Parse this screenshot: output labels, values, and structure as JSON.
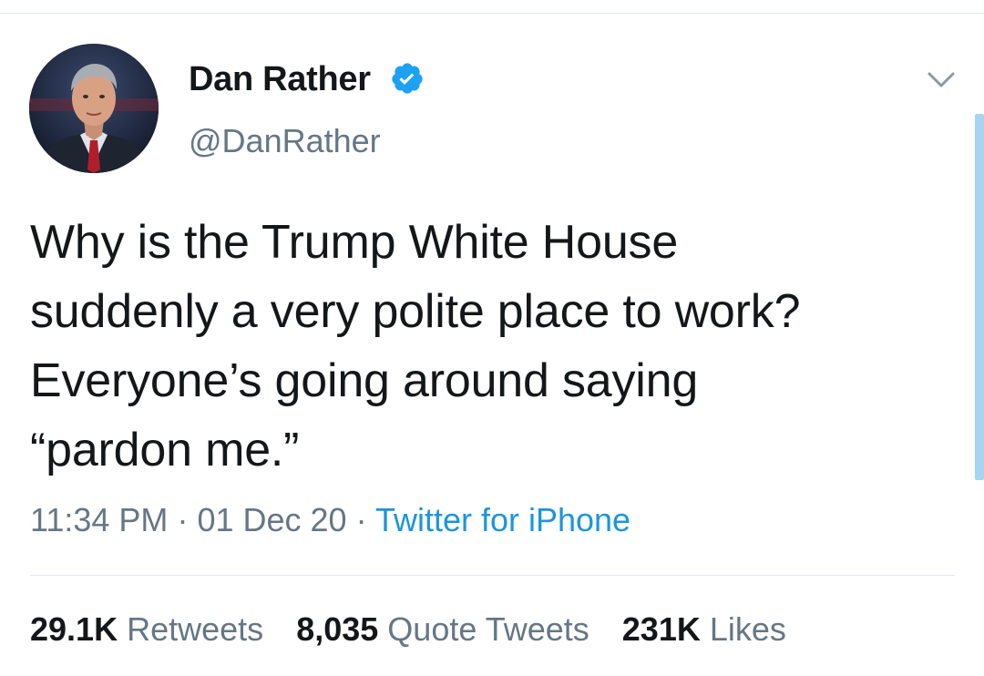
{
  "author": {
    "display_name": "Dan Rather",
    "handle": "@DanRather",
    "verified": true,
    "avatar_icon": "profile-photo",
    "verified_icon": "verified-badge-icon",
    "menu_icon": "chevron-down-icon"
  },
  "tweet": {
    "lines": [
      "Why is the Trump White House",
      "suddenly a very polite place to work?",
      "Everyone’s going around saying",
      "“pardon me.”"
    ]
  },
  "meta": {
    "time": "11:34 PM",
    "separator": "·",
    "date": "01 Dec 20",
    "source": "Twitter for iPhone"
  },
  "stats": {
    "retweets_count": "29.1K",
    "retweets_label": "Retweets",
    "quote_tweets_count": "8,035",
    "quote_tweets_label": "Quote Tweets",
    "likes_count": "231K",
    "likes_label": "Likes"
  },
  "colors": {
    "text_primary": "#14171a",
    "text_secondary": "#657786",
    "link": "#1b95e0",
    "verified": "#1da1f2",
    "divider": "#e1e8ed"
  }
}
